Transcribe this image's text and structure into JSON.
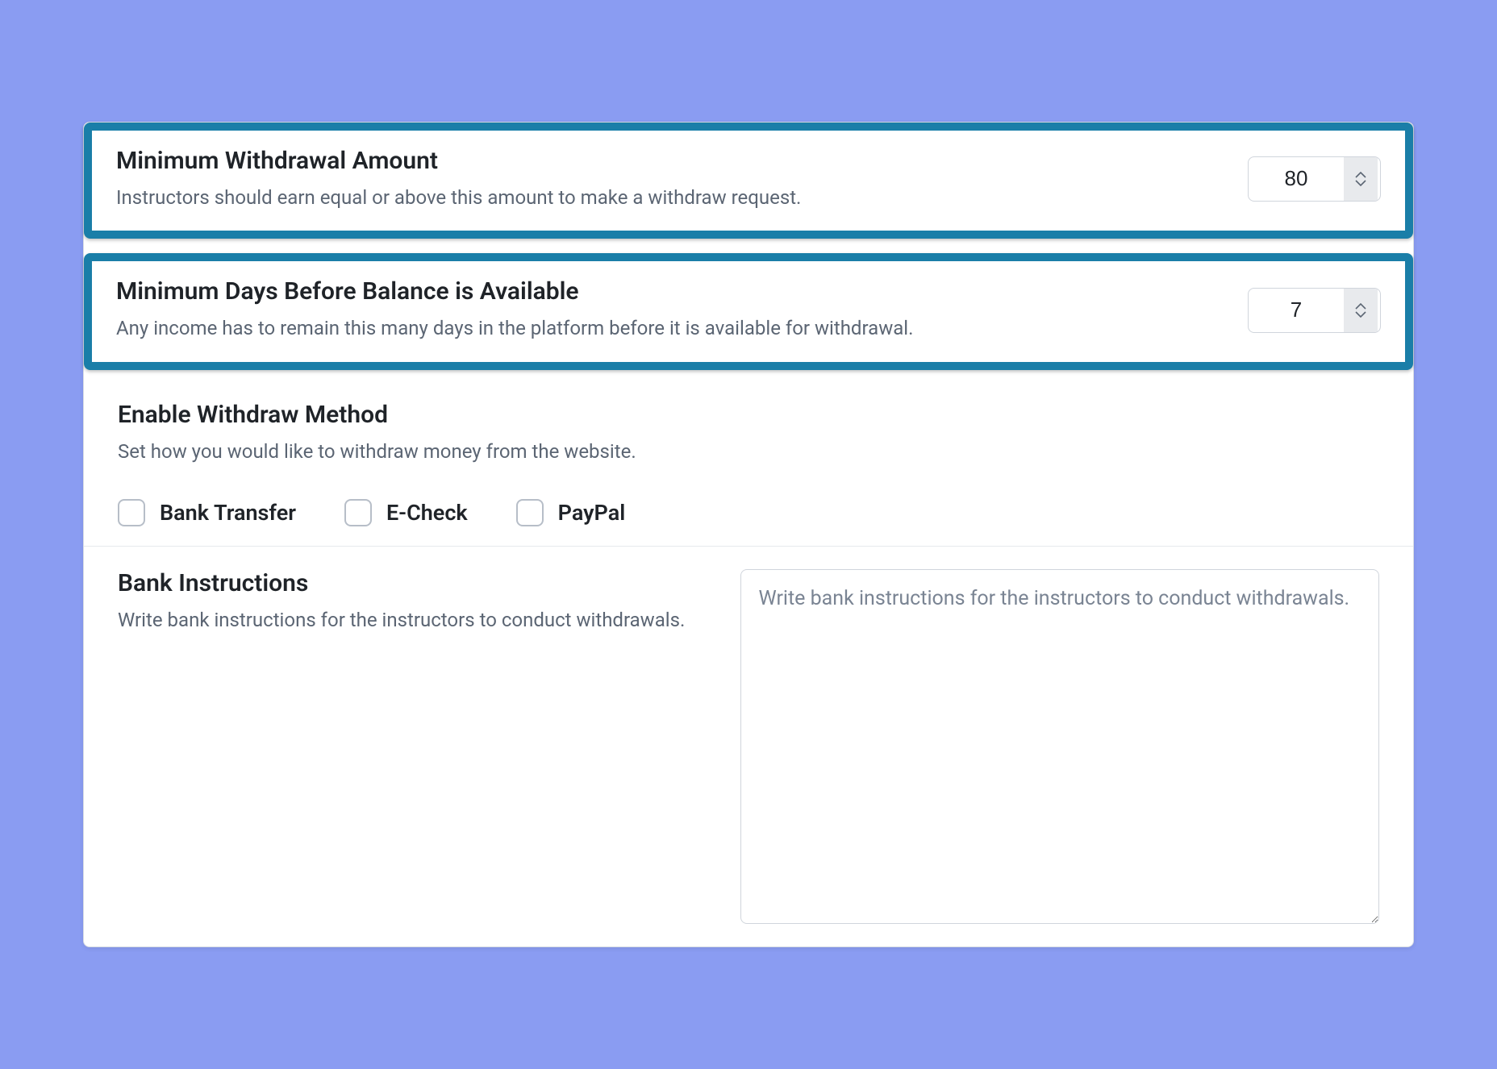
{
  "settings": {
    "min_withdrawal": {
      "title": "Minimum Withdrawal Amount",
      "desc": "Instructors should earn equal or above this amount to make a withdraw request.",
      "value": "80"
    },
    "min_days": {
      "title": "Minimum Days Before Balance is Available",
      "desc": "Any income has to remain this many days in the platform before it is available for withdrawal.",
      "value": "7"
    },
    "enable_method": {
      "title": "Enable Withdraw Method",
      "desc": "Set how you would like to withdraw money from the website.",
      "options": {
        "bank": "Bank Transfer",
        "echeck": "E-Check",
        "paypal": "PayPal"
      }
    },
    "bank_instructions": {
      "title": "Bank Instructions",
      "desc": "Write bank instructions for the instructors to conduct withdrawals.",
      "placeholder": "Write bank instructions for the instructors to conduct withdrawals."
    }
  },
  "colors": {
    "highlight_border": "#1a7ea8",
    "page_bg": "#8a9cf2"
  }
}
